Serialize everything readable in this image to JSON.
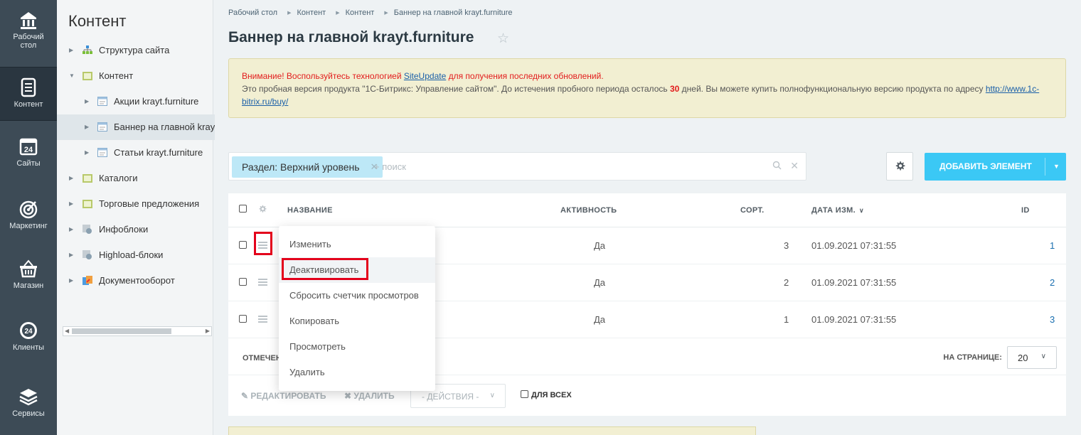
{
  "leftbar": {
    "items": [
      {
        "label": "Рабочий стол",
        "icon": "home-icon"
      },
      {
        "label": "Контент",
        "icon": "document-icon"
      },
      {
        "label": "Сайты",
        "icon": "calendar-24-icon"
      },
      {
        "label": "Маркетинг",
        "icon": "target-icon"
      },
      {
        "label": "Магазин",
        "icon": "basket-icon"
      },
      {
        "label": "Клиенты",
        "icon": "clients-24-icon"
      },
      {
        "label": "Сервисы",
        "icon": "layers-icon"
      }
    ]
  },
  "tree": {
    "title": "Контент",
    "items": [
      {
        "label": "Структура сайта",
        "icon": "sitemap-icon"
      },
      {
        "label": "Контент",
        "icon": "folder-icon"
      },
      {
        "label": "Акции krayt.furniture",
        "icon": "list-icon"
      },
      {
        "label": "Баннер на главной krayt",
        "icon": "list-icon"
      },
      {
        "label": "Статьи krayt.furniture",
        "icon": "list-icon"
      },
      {
        "label": "Каталоги",
        "icon": "folder-icon"
      },
      {
        "label": "Торговые предложения",
        "icon": "folder-icon"
      },
      {
        "label": "Инфоблоки",
        "icon": "infoblocks-icon"
      },
      {
        "label": "Highload-блоки",
        "icon": "infoblocks-icon"
      },
      {
        "label": "Документооборот",
        "icon": "docflow-icon"
      }
    ]
  },
  "breadcrumbs": [
    "Рабочий стол",
    "Контент",
    "Контент",
    "Баннер на главной krayt.furniture"
  ],
  "page_title": "Баннер на главной krayt.furniture",
  "notice": {
    "warn_prefix": "Внимание! Воспользуйтесь технологией ",
    "warn_link": "SiteUpdate",
    "warn_suffix": " для получения последних обновлений.",
    "text1": "Это пробная версия продукта \"1С-Битрикс: Управление сайтом\". До истечения пробного периода осталось ",
    "days": "30",
    "text2": " дней. Вы можете купить полнофункциональную версию продукта по адресу ",
    "link": "http://www.1c-bitrix.ru/buy/"
  },
  "filter": {
    "chip": "Раздел: Верхний уровень",
    "placeholder": "+ поиск"
  },
  "toolbar": {
    "add_label": "ДОБАВИТЬ ЭЛЕМЕНТ"
  },
  "table": {
    "columns": {
      "name": "НАЗВАНИЕ",
      "active": "АКТИВНОСТЬ",
      "sort": "СОРТ.",
      "date": "ДАТА ИЗМ.",
      "id": "ID"
    },
    "rows": [
      {
        "active": "Да",
        "sort": "3",
        "date": "01.09.2021 07:31:55",
        "id": "1"
      },
      {
        "active": "Да",
        "sort": "2",
        "date": "01.09.2021 07:31:55",
        "id": "2"
      },
      {
        "active": "Да",
        "sort": "1",
        "date": "01.09.2021 07:31:55",
        "id": "3"
      }
    ],
    "marked_label": "ОТМЕЧЕН",
    "per_page_label": "НА СТРАНИЦЕ:",
    "per_page_value": "20"
  },
  "actions": {
    "edit": "РЕДАКТИРОВАТЬ",
    "delete": "УДАЛИТЬ",
    "select": "- ДЕЙСТВИЯ -",
    "for_all": "ДЛЯ ВСЕХ"
  },
  "context_menu": [
    "Изменить",
    "Деактивировать",
    "Сбросить счетчик просмотров",
    "Копировать",
    "Просмотреть",
    "Удалить"
  ],
  "colors": {
    "accent": "#3bc8f5",
    "highlight": "#e3001b",
    "sidebar": "#3d4b56"
  }
}
